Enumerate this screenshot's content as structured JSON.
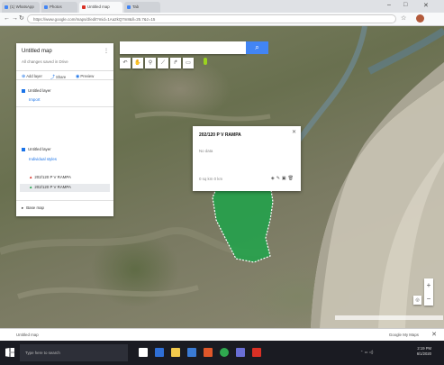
{
  "browser": {
    "tabs": [
      {
        "label": "(1) WhatsApp"
      },
      {
        "label": "Photos"
      },
      {
        "label": "Untitled map"
      },
      {
        "label": "Tab"
      }
    ],
    "url": "https://www.google.com/maps/d/edit?mid=1Aa2kQ7m8&ll=25.7&z=15",
    "window_controls": [
      "–",
      "□",
      "✕"
    ]
  },
  "panel": {
    "title": "Untitled map",
    "subtitle": "All changes saved in Drive",
    "actions": [
      {
        "label": "Add layer",
        "icon": "add-layer-icon"
      },
      {
        "label": "Share",
        "icon": "share-icon"
      },
      {
        "label": "Preview",
        "icon": "preview-icon"
      }
    ],
    "layers": [
      {
        "label": "Untitled layer",
        "checked": true
      },
      {
        "label": "Import",
        "link": true
      }
    ],
    "layer2": {
      "title": "Untitled layer",
      "style_link": "Individual styles",
      "items": [
        {
          "label": "202/120 P V RAMPA",
          "selected": false
        },
        {
          "label": "202/120 P V RAMPA",
          "selected": true
        }
      ]
    },
    "basemap": "Base map"
  },
  "infocard": {
    "title": "202/120 P V RAMPA",
    "subtitle": "No data",
    "foot": "0 sq km  0 km"
  },
  "statusbar": {
    "left": "Untitled map",
    "right": "Google My Maps"
  },
  "taskbar": {
    "search_placeholder": "Type here to search",
    "time": "2:19 PM",
    "date": "6/1/2020"
  },
  "colors": {
    "accent": "#4285f4",
    "polygon_fill": "#1fa34a",
    "pin": "#9bd31f"
  }
}
